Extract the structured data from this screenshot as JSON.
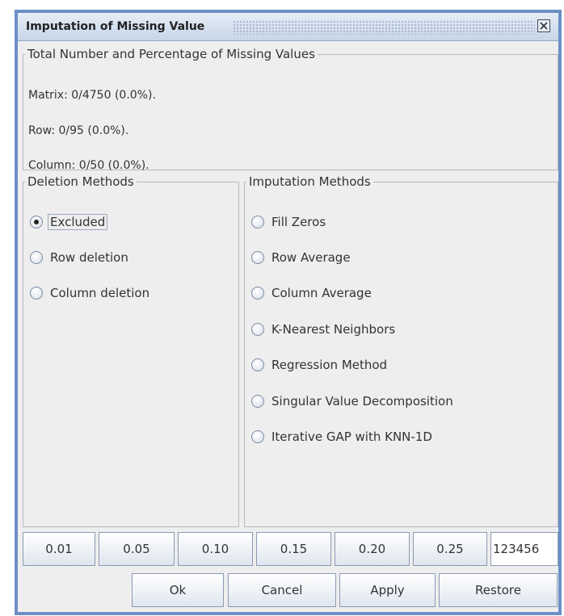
{
  "window": {
    "title": "Imputation of Missing Value"
  },
  "stats": {
    "legend": "Total Number and Percentage of Missing Values",
    "matrix": "Matrix: 0/4750 (0.0%).",
    "row": "Row: 0/95 (0.0%).",
    "column": "Column: 0/50 (0.0%)."
  },
  "deletion": {
    "legend": "Deletion Methods",
    "selected": "Excluded",
    "options": [
      "Excluded",
      "Row deletion",
      "Column deletion"
    ]
  },
  "imputation": {
    "legend": "Imputation Methods",
    "options": [
      "Fill Zeros",
      "Row Average",
      "Column Average",
      "K-Nearest Neighbors",
      "Regression Method",
      "Singular Value Decomposition",
      "Iterative GAP with KNN-1D"
    ]
  },
  "percent_buttons": [
    "0.01",
    "0.05",
    "0.10",
    "0.15",
    "0.20",
    "0.25"
  ],
  "seed_field": {
    "value": "123456"
  },
  "actions": {
    "ok": "Ok",
    "cancel": "Cancel",
    "apply": "Apply",
    "restore": "Restore"
  },
  "icons": {
    "close": "close-icon"
  }
}
